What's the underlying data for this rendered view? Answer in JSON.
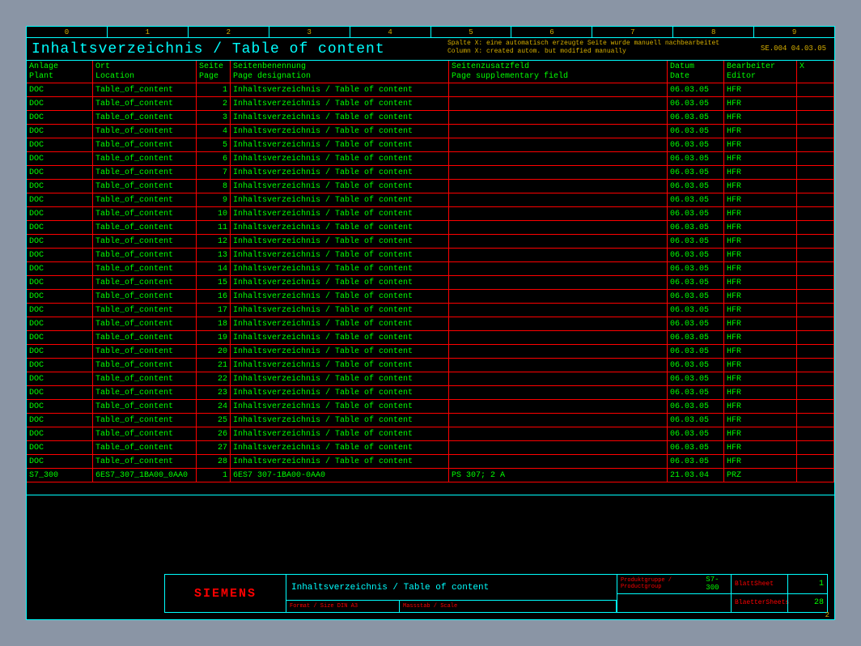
{
  "ruler": [
    "0",
    "1",
    "2",
    "3",
    "4",
    "5",
    "6",
    "7",
    "8",
    "9"
  ],
  "title": "Inhaltsverzeichnis / Table of content",
  "note_line1": "Spalte X: eine automatisch erzeugte Seite wurde manuell nachbearbeitet",
  "note_line2": "Column X: created autom. but modified manually",
  "stamp": "SE.004 04.03.05",
  "headers": {
    "plant": "Anlage\nPlant",
    "location": "Ort\nLocation",
    "page": "Seite\nPage",
    "designation": "Seitenbenennung\nPage designation",
    "supplementary": "Seitenzusatzfeld\nPage supplementary field",
    "date": "Datum\nDate",
    "editor": "Bearbeiter\nEditor",
    "x": "X"
  },
  "rows": [
    {
      "plant": "DOC",
      "loc": "Table_of_content",
      "page": "1",
      "desig": "Inhaltsverzeichnis / Table of content",
      "supp": "",
      "date": "06.03.05",
      "edit": "HFR"
    },
    {
      "plant": "DOC",
      "loc": "Table_of_content",
      "page": "2",
      "desig": "Inhaltsverzeichnis / Table of content",
      "supp": "",
      "date": "06.03.05",
      "edit": "HFR"
    },
    {
      "plant": "DOC",
      "loc": "Table_of_content",
      "page": "3",
      "desig": "Inhaltsverzeichnis / Table of content",
      "supp": "",
      "date": "06.03.05",
      "edit": "HFR"
    },
    {
      "plant": "DOC",
      "loc": "Table_of_content",
      "page": "4",
      "desig": "Inhaltsverzeichnis / Table of content",
      "supp": "",
      "date": "06.03.05",
      "edit": "HFR"
    },
    {
      "plant": "DOC",
      "loc": "Table_of_content",
      "page": "5",
      "desig": "Inhaltsverzeichnis / Table of content",
      "supp": "",
      "date": "06.03.05",
      "edit": "HFR"
    },
    {
      "plant": "DOC",
      "loc": "Table_of_content",
      "page": "6",
      "desig": "Inhaltsverzeichnis / Table of content",
      "supp": "",
      "date": "06.03.05",
      "edit": "HFR"
    },
    {
      "plant": "DOC",
      "loc": "Table_of_content",
      "page": "7",
      "desig": "Inhaltsverzeichnis / Table of content",
      "supp": "",
      "date": "06.03.05",
      "edit": "HFR"
    },
    {
      "plant": "DOC",
      "loc": "Table_of_content",
      "page": "8",
      "desig": "Inhaltsverzeichnis / Table of content",
      "supp": "",
      "date": "06.03.05",
      "edit": "HFR"
    },
    {
      "plant": "DOC",
      "loc": "Table_of_content",
      "page": "9",
      "desig": "Inhaltsverzeichnis / Table of content",
      "supp": "",
      "date": "06.03.05",
      "edit": "HFR"
    },
    {
      "plant": "DOC",
      "loc": "Table_of_content",
      "page": "10",
      "desig": "Inhaltsverzeichnis / Table of content",
      "supp": "",
      "date": "06.03.05",
      "edit": "HFR"
    },
    {
      "plant": "DOC",
      "loc": "Table_of_content",
      "page": "11",
      "desig": "Inhaltsverzeichnis / Table of content",
      "supp": "",
      "date": "06.03.05",
      "edit": "HFR"
    },
    {
      "plant": "DOC",
      "loc": "Table_of_content",
      "page": "12",
      "desig": "Inhaltsverzeichnis / Table of content",
      "supp": "",
      "date": "06.03.05",
      "edit": "HFR"
    },
    {
      "plant": "DOC",
      "loc": "Table_of_content",
      "page": "13",
      "desig": "Inhaltsverzeichnis / Table of content",
      "supp": "",
      "date": "06.03.05",
      "edit": "HFR"
    },
    {
      "plant": "DOC",
      "loc": "Table_of_content",
      "page": "14",
      "desig": "Inhaltsverzeichnis / Table of content",
      "supp": "",
      "date": "06.03.05",
      "edit": "HFR"
    },
    {
      "plant": "DOC",
      "loc": "Table_of_content",
      "page": "15",
      "desig": "Inhaltsverzeichnis / Table of content",
      "supp": "",
      "date": "06.03.05",
      "edit": "HFR"
    },
    {
      "plant": "DOC",
      "loc": "Table_of_content",
      "page": "16",
      "desig": "Inhaltsverzeichnis / Table of content",
      "supp": "",
      "date": "06.03.05",
      "edit": "HFR"
    },
    {
      "plant": "DOC",
      "loc": "Table_of_content",
      "page": "17",
      "desig": "Inhaltsverzeichnis / Table of content",
      "supp": "",
      "date": "06.03.05",
      "edit": "HFR"
    },
    {
      "plant": "DOC",
      "loc": "Table_of_content",
      "page": "18",
      "desig": "Inhaltsverzeichnis / Table of content",
      "supp": "",
      "date": "06.03.05",
      "edit": "HFR"
    },
    {
      "plant": "DOC",
      "loc": "Table_of_content",
      "page": "19",
      "desig": "Inhaltsverzeichnis / Table of content",
      "supp": "",
      "date": "06.03.05",
      "edit": "HFR"
    },
    {
      "plant": "DOC",
      "loc": "Table_of_content",
      "page": "20",
      "desig": "Inhaltsverzeichnis / Table of content",
      "supp": "",
      "date": "06.03.05",
      "edit": "HFR"
    },
    {
      "plant": "DOC",
      "loc": "Table_of_content",
      "page": "21",
      "desig": "Inhaltsverzeichnis / Table of content",
      "supp": "",
      "date": "06.03.05",
      "edit": "HFR"
    },
    {
      "plant": "DOC",
      "loc": "Table_of_content",
      "page": "22",
      "desig": "Inhaltsverzeichnis / Table of content",
      "supp": "",
      "date": "06.03.05",
      "edit": "HFR"
    },
    {
      "plant": "DOC",
      "loc": "Table_of_content",
      "page": "23",
      "desig": "Inhaltsverzeichnis / Table of content",
      "supp": "",
      "date": "06.03.05",
      "edit": "HFR"
    },
    {
      "plant": "DOC",
      "loc": "Table_of_content",
      "page": "24",
      "desig": "Inhaltsverzeichnis / Table of content",
      "supp": "",
      "date": "06.03.05",
      "edit": "HFR"
    },
    {
      "plant": "DOC",
      "loc": "Table_of_content",
      "page": "25",
      "desig": "Inhaltsverzeichnis / Table of content",
      "supp": "",
      "date": "06.03.05",
      "edit": "HFR"
    },
    {
      "plant": "DOC",
      "loc": "Table_of_content",
      "page": "26",
      "desig": "Inhaltsverzeichnis / Table of content",
      "supp": "",
      "date": "06.03.05",
      "edit": "HFR"
    },
    {
      "plant": "DOC",
      "loc": "Table_of_content",
      "page": "27",
      "desig": "Inhaltsverzeichnis / Table of content",
      "supp": "",
      "date": "06.03.05",
      "edit": "HFR"
    },
    {
      "plant": "DOC",
      "loc": "Table_of_content",
      "page": "28",
      "desig": "Inhaltsverzeichnis / Table of content",
      "supp": "",
      "date": "06.03.05",
      "edit": "HFR"
    },
    {
      "plant": "S7_300",
      "loc": "6ES7_307_1BA00_0AA0",
      "page": "1",
      "desig": "6ES7 307-1BA00-0AA0",
      "supp": "PS 307; 2 A",
      "date": "21.03.04",
      "edit": "PRZ"
    }
  ],
  "titleblock": {
    "logo": "SIEMENS",
    "title": "Inhaltsverzeichnis / Table of content",
    "format_label": "Format / Size  DIN A3",
    "scale_label": "Massstab / Scale",
    "product_label": "Produktgruppe / Productgroup",
    "product_value": "S7-300",
    "sheet_label": "Blatt\nSheet",
    "sheet_value": "1",
    "sheets_label": "Blaetter\nSheets",
    "sheets_value": "28"
  },
  "bottom_page": "2"
}
